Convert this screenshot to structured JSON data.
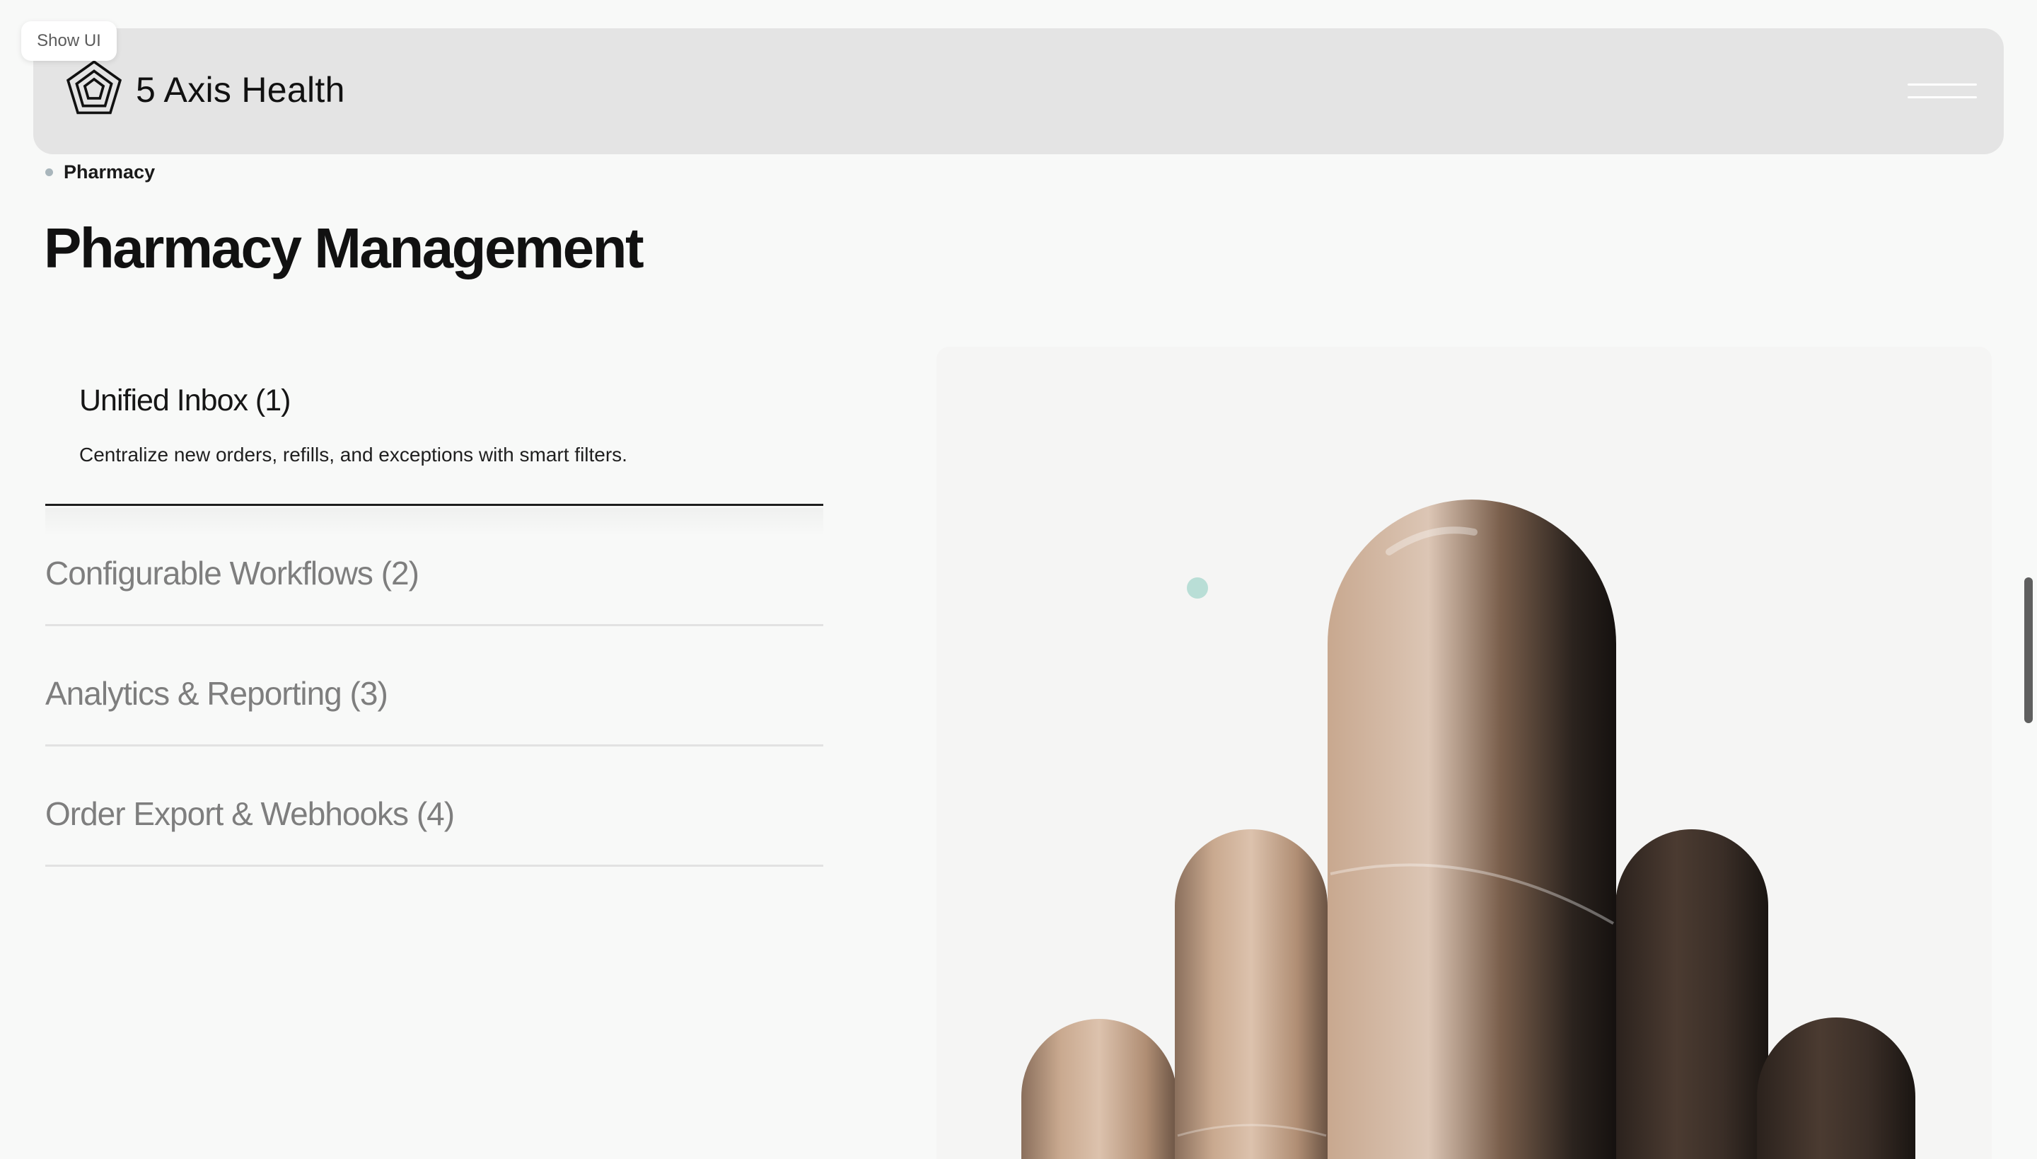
{
  "show_ui": {
    "label": "Show UI"
  },
  "header": {
    "brand": "5 Axis Health",
    "logo_icon": "pentagon-logo-icon",
    "menu_icon": "hamburger-menu-icon"
  },
  "breadcrumb": {
    "label": "Pharmacy"
  },
  "page": {
    "title": "Pharmacy Management"
  },
  "features": [
    {
      "title": "Unified Inbox (1)",
      "description": "Centralize new orders, refills, and exceptions with smart filters.",
      "expanded": true
    },
    {
      "title": "Configurable Workflows (2)",
      "expanded": false
    },
    {
      "title": "Analytics & Reporting (3)",
      "expanded": false
    },
    {
      "title": "Order Export & Webhooks (4)",
      "expanded": false
    }
  ],
  "colors": {
    "background": "#f8f9f8",
    "header_bg": "#e4e4e4",
    "active_text": "#161616",
    "inactive_text": "#7e7e7e",
    "accent_dot": "#b9ded6"
  }
}
